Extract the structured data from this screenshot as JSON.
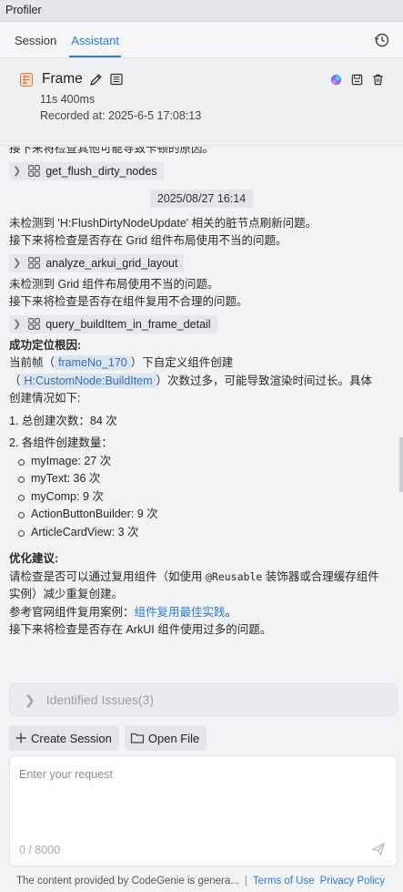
{
  "window": {
    "title": "Profiler"
  },
  "tabs": [
    {
      "label": "Session"
    },
    {
      "label": "Assistant"
    }
  ],
  "frame": {
    "title": "Frame",
    "duration": "11s 400ms",
    "recorded": "Recorded at: 2025-6-5 17:08:13"
  },
  "chat": {
    "line_top": "接下来将检查其他可能导致卡顿的原因。",
    "tool1": "get_flush_dirty_nodes",
    "timestamp": "2025/08/27 16:14",
    "msg1_line1": "未检测到 'H:FlushDirtyNodeUpdate' 相关的脏节点刷新问题。",
    "msg1_line2": "接下来将检查是否存在 Grid 组件布局使用不当的问题。",
    "tool2": "analyze_arkui_grid_layout",
    "msg2_line1": "未检测到 Grid 组件布局使用不当的问题。",
    "msg2_line2": "接下来将检查是否存在组件复用不合理的问题。",
    "tool3": "query_buildItem_in_frame_detail",
    "root_title": "成功定位根因:",
    "root_p1_a": "当前帧（",
    "root_frame_chip": "frameNo_170",
    "root_p1_b": "）下自定义组件创建",
    "root_p2_a": "（",
    "root_node_chip": "H:CustomNode:BuildItem",
    "root_p2_b": "）次数过多，可能导致渲染时间过长。具体",
    "root_p3": "创建情况如下:",
    "item1": "1. 总创建次数：84 次",
    "item2": "2. 各组件创建数量：",
    "sub_items": [
      "myImage: 27 次",
      "myText: 36 次",
      "myComp: 9 次",
      "ActionButtonBuilder: 9 次",
      "ArticleCardView: 3 次"
    ],
    "opt_title": "优化建议:",
    "opt_l1_a": "请检查是否可以通过复用组件（如使用 ",
    "opt_l1_code": "@Reusable",
    "opt_l1_b": " 装饰器或合理缓存组件",
    "opt_l2": "实例）减少重复创建。",
    "opt_l3_a": "参考官网组件复用案例：",
    "opt_l3_link": "组件复用最佳实践",
    "opt_l3_b": "。",
    "opt_l4": "接下来将检查是否存在 ArkUI 组件使用过多的问题。"
  },
  "issues": {
    "label": "Identified Issues(3)"
  },
  "actions": {
    "create_session": "Create Session",
    "open_file": "Open File"
  },
  "input": {
    "placeholder": "Enter your request",
    "counter": "0 / 8000"
  },
  "footer": {
    "text": "The content provided by CodeGenie is genera...",
    "separator": "|",
    "terms": "Terms of Use",
    "privacy": "Privacy Policy"
  },
  "colors": {
    "accent": "#2a7be4",
    "frame_icon": "#e8773a"
  },
  "icons": {
    "history": "history-icon",
    "frame": "frame-icon",
    "edit": "edit-icon",
    "document": "document-icon",
    "genie": "genie-icon",
    "save": "save-icon",
    "delete": "delete-icon",
    "chevron": "chevron-right-icon",
    "grid": "grid-icon",
    "plus": "plus-icon",
    "folder": "folder-icon",
    "send": "send-icon"
  }
}
